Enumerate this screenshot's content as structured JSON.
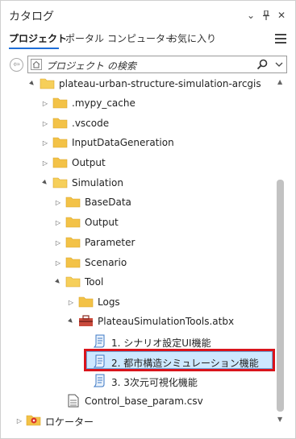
{
  "header": {
    "title": "カタログ",
    "chevron": "⌄",
    "pin": "⊥",
    "close": "✕"
  },
  "tabs": [
    {
      "label": "プロジェクト",
      "active": true
    },
    {
      "label": "ポータル"
    },
    {
      "label": "コンピューター"
    },
    {
      "label": "お気に入り"
    }
  ],
  "search": {
    "placeholder": "プロジェクト の検索",
    "back_icon": "⇦"
  },
  "tree": [
    {
      "label": "plateau-urban-structure-simulation-arcgis",
      "icon": "folder-open",
      "expander": "▲"
    },
    {
      "label": ".mypy_cache",
      "icon": "folder",
      "expander": "▷"
    },
    {
      "label": ".vscode",
      "icon": "folder",
      "expander": "▷"
    },
    {
      "label": "InputDataGeneration",
      "icon": "folder",
      "expander": "▷"
    },
    {
      "label": "Output",
      "icon": "folder",
      "expander": "▷"
    },
    {
      "label": "Simulation",
      "icon": "folder-open",
      "expander": "▲"
    },
    {
      "label": "BaseData",
      "icon": "folder",
      "expander": "▷"
    },
    {
      "label": "Output",
      "icon": "folder",
      "expander": "▷"
    },
    {
      "label": "Parameter",
      "icon": "folder",
      "expander": "▷"
    },
    {
      "label": "Scenario",
      "icon": "folder",
      "expander": "▷"
    },
    {
      "label": "Tool",
      "icon": "folder-open",
      "expander": "▲"
    },
    {
      "label": "Logs",
      "icon": "folder",
      "expander": "▷"
    },
    {
      "label": "PlateauSimulationTools.atbx",
      "icon": "toolbox",
      "expander": "▲"
    },
    {
      "label": "1. シナリオ設定UI機能",
      "icon": "script"
    },
    {
      "label": "2. 都市構造シミュレーション機能",
      "icon": "script",
      "selected": true
    },
    {
      "label": "3. 3次元可視化機能",
      "icon": "script"
    },
    {
      "label": "Control_base_param.csv",
      "icon": "csv-file"
    },
    {
      "label": "ロケーター",
      "icon": "locator",
      "expander": "▷"
    }
  ]
}
